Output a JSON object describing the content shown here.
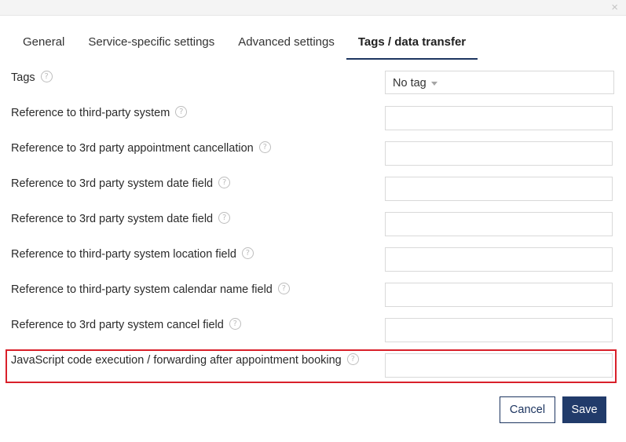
{
  "dialog": {
    "close_glyph": "×"
  },
  "tabs": [
    {
      "label": "General",
      "active": false
    },
    {
      "label": "Service-specific settings",
      "active": false
    },
    {
      "label": "Advanced settings",
      "active": false
    },
    {
      "label": "Tags / data transfer",
      "active": true
    }
  ],
  "form": {
    "help_glyph": "?",
    "tags": {
      "label": "Tags",
      "value": "No tag"
    },
    "fields": [
      {
        "label": "Reference to third-party system",
        "value": ""
      },
      {
        "label": "Reference to 3rd party appointment cancellation",
        "value": ""
      },
      {
        "label": "Reference to 3rd party system date field",
        "value": ""
      },
      {
        "label": "Reference to 3rd party system date field",
        "value": ""
      },
      {
        "label": "Reference to third-party system location field",
        "value": ""
      },
      {
        "label": "Reference to third-party system calendar name field",
        "value": ""
      },
      {
        "label": "Reference to 3rd party system cancel field",
        "value": ""
      },
      {
        "label": "JavaScript code execution / forwarding after appointment booking",
        "value": ""
      }
    ]
  },
  "footer": {
    "cancel_label": "Cancel",
    "save_label": "Save"
  },
  "colors": {
    "primary": "#213b6a",
    "highlight": "#d9202a",
    "border": "#d9d9d9"
  }
}
